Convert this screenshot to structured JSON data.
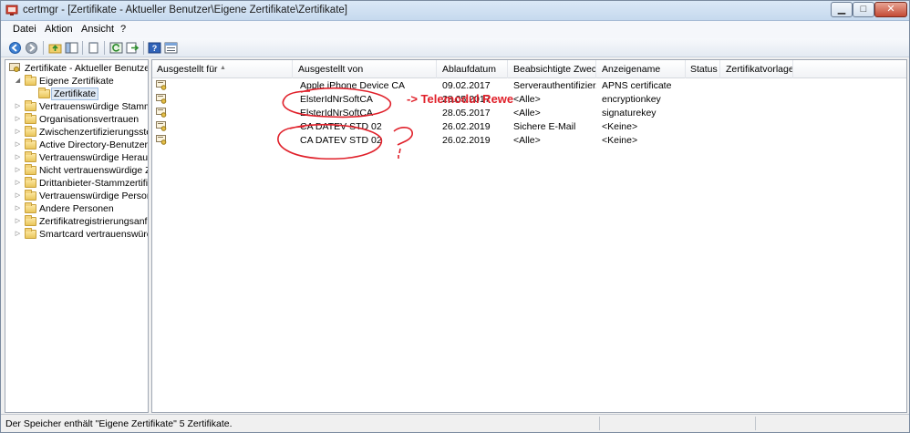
{
  "window": {
    "title": "certmgr - [Zertifikate - Aktueller Benutzer\\Eigene Zertifikate\\Zertifikate]",
    "minimize_icon": "minimize-icon",
    "maximize_icon": "maximize-icon",
    "close_icon": "close-icon"
  },
  "menu": {
    "items": [
      "Datei",
      "Aktion",
      "Ansicht",
      "?"
    ]
  },
  "toolbar": {
    "buttons": [
      "back-arrow-icon",
      "forward-arrow-icon",
      "up-folder-icon",
      "show-hide-tree-icon",
      "properties-icon",
      "refresh-icon",
      "export-icon",
      "help-icon",
      "view-icon"
    ]
  },
  "tree": {
    "root": "Zertifikate - Aktueller Benutzer",
    "items": [
      {
        "label": "Eigene Zertifikate",
        "expanded": true
      },
      {
        "label": "Zertifikate",
        "selected": true
      },
      {
        "label": "Vertrauenswürdige Stammzer"
      },
      {
        "label": "Organisationsvertrauen"
      },
      {
        "label": "Zwischenzertifizierungsstelle"
      },
      {
        "label": "Active Directory-Benutzerobj"
      },
      {
        "label": "Vertrauenswürdige Herausge"
      },
      {
        "label": "Nicht vertrauenswürdige Zert"
      },
      {
        "label": "Drittanbieter-Stammzertifizie"
      },
      {
        "label": "Vertrauenswürdige Personen"
      },
      {
        "label": "Andere Personen"
      },
      {
        "label": "Zertifikatregistrierungsanford"
      },
      {
        "label": "Smartcard vertrauenswürdige"
      }
    ]
  },
  "table": {
    "columns": [
      "Ausgestellt für",
      "Ausgestellt von",
      "Ablaufdatum",
      "Beabsichtigte Zwec...",
      "Anzeigename",
      "Status",
      "Zertifikatvorlage"
    ],
    "rows": [
      {
        "issued_to": "",
        "issued_by": "Apple iPhone Device CA",
        "expires": "09.02.2017",
        "purpose": "Serverauthentifizier...",
        "name": "APNS certificate",
        "status": "",
        "template": ""
      },
      {
        "issued_to": "",
        "issued_by": "ElsterIdNrSoftCA",
        "expires": "28.05.2017",
        "purpose": "<Alle>",
        "name": "encryptionkey",
        "status": "",
        "template": ""
      },
      {
        "issued_to": "",
        "issued_by": "ElsterIdNrSoftCA",
        "expires": "28.05.2017",
        "purpose": "<Alle>",
        "name": "signaturekey",
        "status": "",
        "template": ""
      },
      {
        "issued_to": "",
        "issued_by": "CA DATEV STD 02",
        "expires": "26.02.2019",
        "purpose": "Sichere E-Mail",
        "name": "<Keine>",
        "status": "",
        "template": ""
      },
      {
        "issued_to": "",
        "issued_by": "CA DATEV STD 02",
        "expires": "26.02.2019",
        "purpose": "<Alle>",
        "name": "<Keine>",
        "status": "",
        "template": ""
      }
    ]
  },
  "annotation": {
    "text": "-> Telemodul Rewe",
    "color": "#e0202a"
  },
  "status": {
    "text": "Der Speicher enthält \"Eigene Zertifikate\" 5 Zertifikate."
  },
  "colors": {
    "accent": "#3a6ea5",
    "annotation_red": "#e0202a"
  }
}
